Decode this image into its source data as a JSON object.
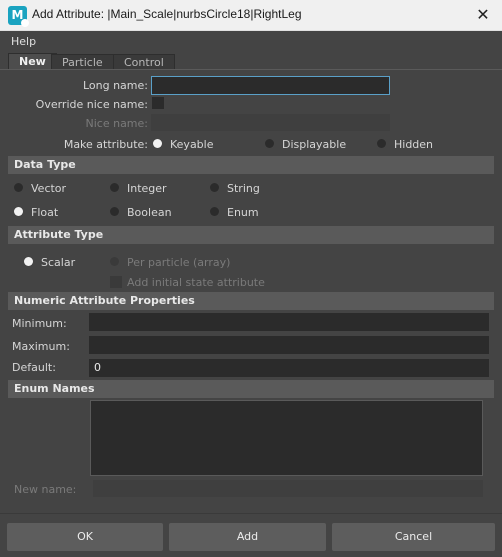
{
  "window": {
    "app_icon_letter": "M",
    "title": "Add Attribute: |Main_Scale|nurbsCircle18|RightLeg",
    "close_glyph": "✕"
  },
  "menu": {
    "help": "Help"
  },
  "tabs": [
    "New",
    "Particle",
    "Control"
  ],
  "new_tab": {
    "long_name_label": "Long name:",
    "long_name_value": "",
    "override_nice_name_label": "Override nice name:",
    "nice_name_label": "Nice name:",
    "nice_name_value": "",
    "make_attribute_label": "Make attribute:",
    "make_attribute_options": [
      "Keyable",
      "Displayable",
      "Hidden"
    ],
    "make_attribute_selected": "Keyable"
  },
  "data_type": {
    "header": "Data Type",
    "options": [
      "Vector",
      "Integer",
      "String",
      "Float",
      "Boolean",
      "Enum"
    ],
    "selected": "Float"
  },
  "attribute_type": {
    "header": "Attribute Type",
    "scalar": "Scalar",
    "per_particle": "Per particle (array)",
    "add_initial_state": "Add initial state attribute",
    "selected": "Scalar"
  },
  "numeric": {
    "header": "Numeric Attribute Properties",
    "minimum_label": "Minimum:",
    "minimum_value": "",
    "maximum_label": "Maximum:",
    "maximum_value": "",
    "default_label": "Default:",
    "default_value": "0"
  },
  "enum": {
    "header": "Enum Names",
    "new_name_label": "New name:",
    "new_name_value": ""
  },
  "buttons": {
    "ok": "OK",
    "add": "Add",
    "cancel": "Cancel"
  },
  "colors": {
    "background": "#444444",
    "section_header": "#5a5a5a",
    "field": "#2b2b2b",
    "focus_border": "#5aa0c8",
    "titlebar": "#f0f0f0"
  }
}
